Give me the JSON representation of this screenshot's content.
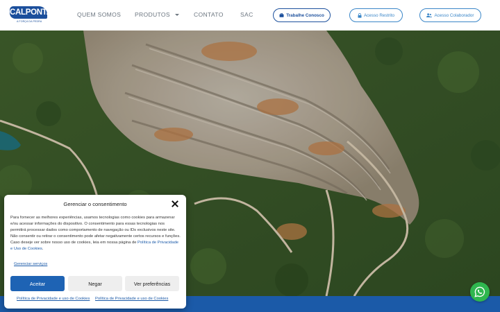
{
  "header": {
    "logo_text": "CALPONTA",
    "logo_tagline": "A FORÇA DA PEDRA",
    "nav": {
      "quem_somos": "QUEM SOMOS",
      "produtos": "PRODUTOS",
      "contato": "CONTATO",
      "sac": "SAC"
    },
    "buttons": {
      "trabalhe": "Trabalhe Conosco",
      "restrito": "Acesso Restrito",
      "colaborador": "Acesso Colaborador"
    }
  },
  "colors": {
    "brand_blue": "#1b4f9c",
    "accent_light_blue": "#3a86c8",
    "accept_button": "#1e63b4",
    "whatsapp_green": "#2fb64f"
  },
  "consent": {
    "title": "Gerenciar o consentimento",
    "body": "Para fornecer as melhores experiências, usamos tecnologias como cookies para armazenar e/ou acessar informações do dispositivo. O consentimento para essas tecnologias nos permitirá processar dados como comportamento de navegação ou IDs exclusivos neste site. Não consentir ou retirar o consentimento pode afetar negativamente certos recursos e funções. Caso deseje ver sobre nosso uso de cookies, leia em nossa página de ",
    "body_link": "Política de Privacidade e Uso de Cookies",
    "body_end": ".",
    "manage_services": "Gerenciar serviços",
    "accept": "Aceitar",
    "deny": "Negar",
    "preferences": "Ver preferências",
    "footer_link_1": "Política de Privacidade e uso de Cookies",
    "footer_link_2": "Política de Privacidade e uso de Cookies"
  },
  "icons": {
    "close": "close-icon",
    "briefcase": "briefcase-icon",
    "lock": "lock-icon",
    "users": "users-icon",
    "whatsapp": "whatsapp-icon",
    "dropdown": "chevron-down-icon"
  }
}
